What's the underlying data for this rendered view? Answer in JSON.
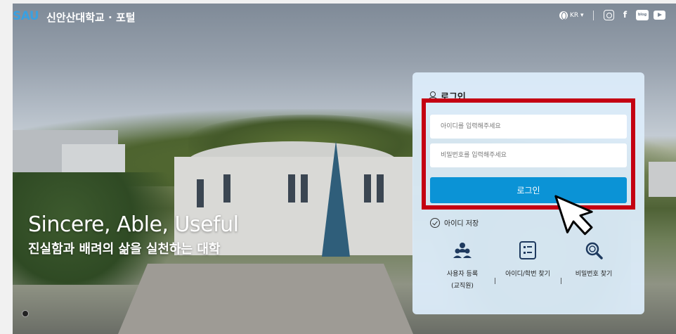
{
  "header": {
    "logo_mark": "SAU",
    "logo_text": "신안산대학교 · 포털",
    "lang_label": "KR ▾",
    "social": [
      "instagram-icon",
      "facebook-icon",
      "blog-icon",
      "youtube-icon"
    ],
    "blog_label": "blog"
  },
  "hero": {
    "slogan_en": "Sincere, Able, Useful",
    "slogan_ko": "진실함과 배려의 삶을 실천하는 대학"
  },
  "login": {
    "title": "로그인",
    "id_placeholder": "아이디를 입력해주세요",
    "pw_placeholder": "비밀번호를 입력해주세요",
    "button_label": "로그인",
    "save_id_label": "아이디 저장",
    "highlight_color": "#c40012",
    "button_color": "#0b93d6"
  },
  "quick_links": [
    {
      "icon": "user-group-icon",
      "label": "사용자 등록\n(교직원)"
    },
    {
      "icon": "list-document-icon",
      "label": "아이디/학번 찾기"
    },
    {
      "icon": "magnifier-icon",
      "label": "비밀번호 찾기"
    }
  ],
  "quick_labels": {
    "register_line1": "사용자 등록",
    "register_line2": "(교직원)",
    "find_id": "아이디/학번 찾기",
    "find_pw": "비밀번호 찾기",
    "separator": "|"
  }
}
